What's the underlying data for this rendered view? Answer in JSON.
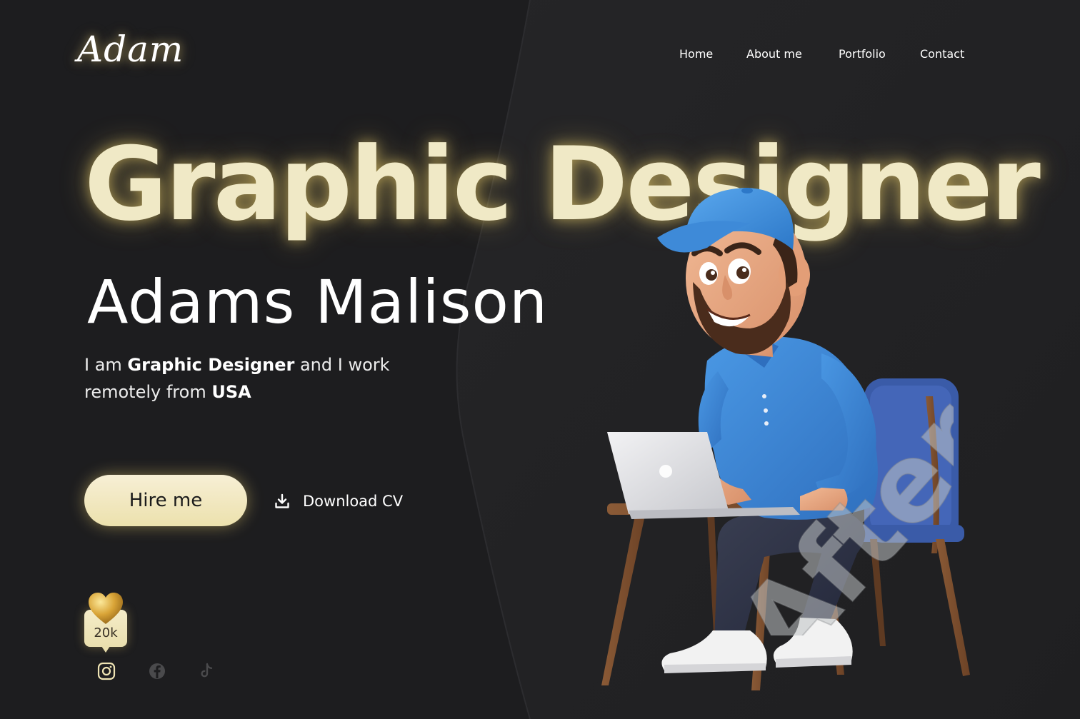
{
  "brand": {
    "logo_text": "Adam"
  },
  "nav": {
    "items": [
      {
        "label": "Home"
      },
      {
        "label": "About me"
      },
      {
        "label": "Portfolio"
      },
      {
        "label": "Contact"
      }
    ]
  },
  "hero": {
    "headline": "Graphic Designer",
    "name": "Adams Malison",
    "intro": {
      "part1": "I am ",
      "role": "Graphic Designer",
      "part2": " and I work remotely from ",
      "location": "USA"
    },
    "hire_label": "Hire me",
    "download_label": "Download CV"
  },
  "likes": {
    "count": "20k",
    "icon": "heart-icon"
  },
  "socials": [
    {
      "name": "instagram",
      "icon": "instagram-icon"
    },
    {
      "name": "facebook",
      "icon": "facebook-icon"
    },
    {
      "name": "tiktok",
      "icon": "tiktok-icon"
    }
  ],
  "watermark": {
    "text": "After"
  },
  "colors": {
    "background": "#1d1d1f",
    "panel": "#222224",
    "accent": "#f0e9c6",
    "button": "#efe4b4",
    "shirt": "#3d8ad8",
    "cap": "#4a9be6",
    "chair": "#3a5ba8"
  }
}
